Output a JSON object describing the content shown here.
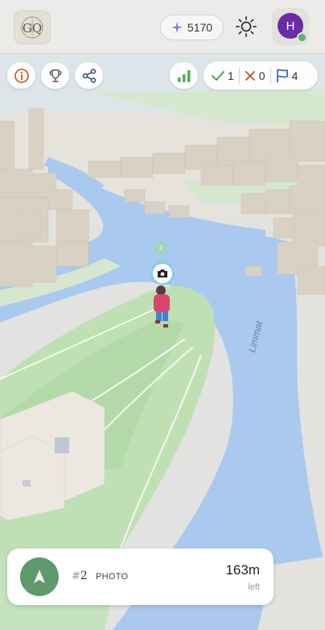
{
  "app": {
    "logo_text": "GQ"
  },
  "header": {
    "points": "5170",
    "avatar_initial": "H"
  },
  "toolbar": {
    "info_icon": "info-icon",
    "trophy_icon": "trophy-icon",
    "share_icon": "share-icon",
    "signal_icon": "signal-icon"
  },
  "stats": {
    "correct": "1",
    "wrong": "0",
    "flags": "4"
  },
  "map": {
    "river_label": "Limmat",
    "marker_count": "2"
  },
  "task": {
    "hash": "#",
    "number": "2",
    "type": "PHOTO",
    "distance": "163m",
    "distance_sub": "left"
  },
  "colors": {
    "accent": "#5f9a6e",
    "avatar": "#6b2aa6",
    "flag": "#3b62b8",
    "wrong": "#b0562f",
    "correct": "#3a9a55"
  }
}
